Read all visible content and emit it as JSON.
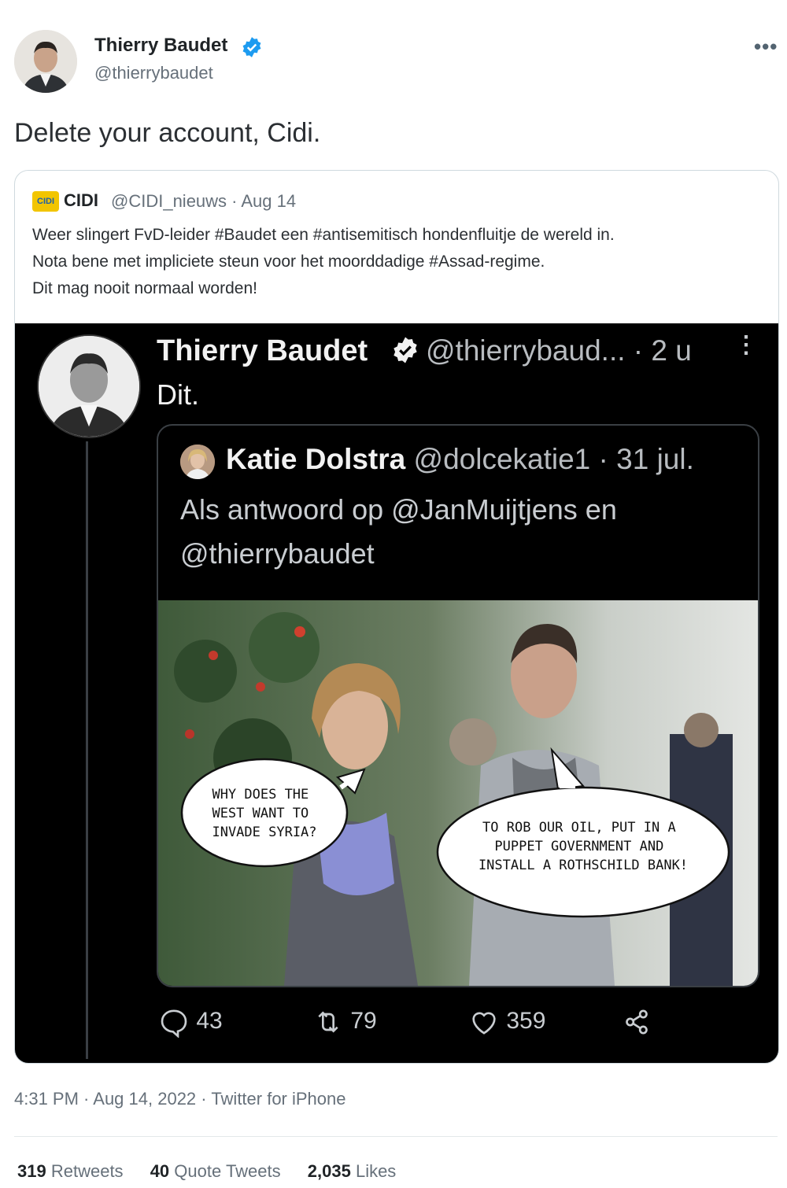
{
  "tweet": {
    "author_name": "Thierry Baudet",
    "author_handle": "@thierrybaudet",
    "text": "Delete your account, Cidi.",
    "more_icon": "more-icon",
    "timestamp": "4:31 PM · Aug 14, 2022 · Twitter for iPhone",
    "stats": {
      "retweets_count": "319",
      "retweets_label": "Retweets",
      "quotes_count": "40",
      "quotes_label": "Quote Tweets",
      "likes_count": "2,035",
      "likes_label": "Likes"
    }
  },
  "quoted": {
    "logo_text": "CIDI",
    "name": "CIDI",
    "handle_date": "@CIDI_nieuws · Aug 14",
    "lines": [
      "Weer slingert FvD-leider #Baudet een #antisemitisch hondenfluitje de wereld in.",
      "Nota bene met impliciete steun voor het moorddadige #Assad-regime.",
      "Dit mag nooit normaal worden!"
    ],
    "embed": {
      "name": "Thierry Baudet",
      "handle_time": "@thierrybaud... · 2 u",
      "text": "Dit.",
      "inner": {
        "name": "Katie Dolstra",
        "handle_date": "@dolcekatie1 · 31 jul.",
        "reply_line1": "Als antwoord op @JanMuijtjens en",
        "reply_line2": "@thierrybaudet",
        "bubble1_lines": [
          "WHY DOES THE",
          "WEST WANT TO",
          "INVADE SYRIA?"
        ],
        "bubble2_lines": [
          "TO ROB OUR OIL, PUT IN A",
          "PUPPET GOVERNMENT AND",
          "INSTALL A ROTHSCHILD BANK!"
        ]
      },
      "actions": {
        "replies": "43",
        "retweets": "79",
        "likes": "359"
      }
    }
  },
  "colors": {
    "verified": "#1d9bf0",
    "embed_bg": "#000000",
    "muted": "#66707a"
  }
}
